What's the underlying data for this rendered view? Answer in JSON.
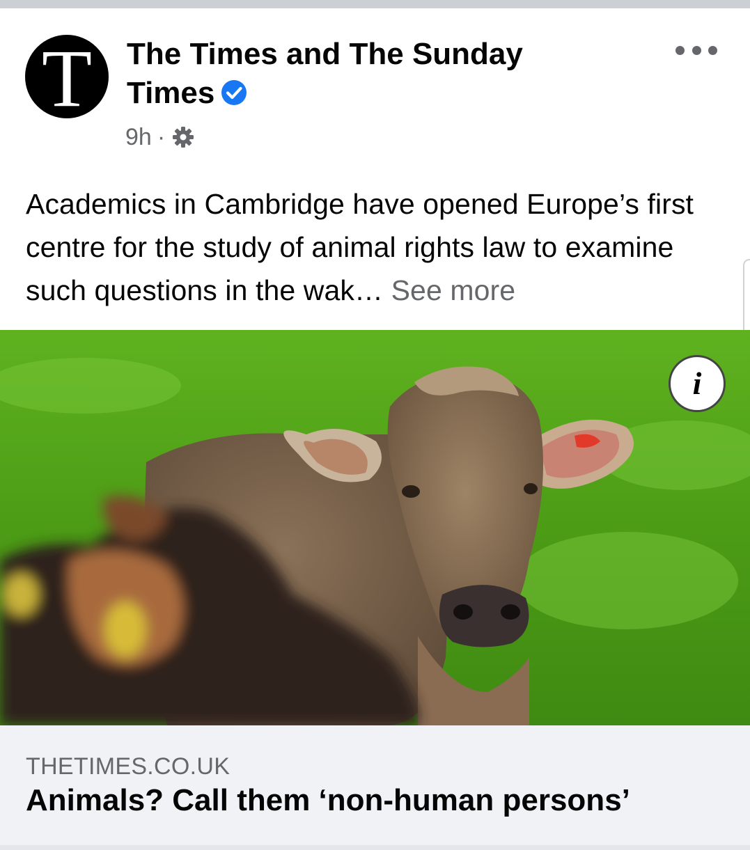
{
  "post": {
    "page_name": "The Times and The Sunday Times",
    "avatar_letter": "T",
    "time": "9h",
    "separator": "·",
    "text": "Academics in Cambridge have opened Europe’s first centre for the study of animal rights law to examine such questions in the wak…",
    "see_more": "See more"
  },
  "link": {
    "domain": "THETIMES.CO.UK",
    "title": "Animals? Call them ‘non-human persons’"
  },
  "icons": {
    "verified": "verified-badge-icon",
    "privacy": "gear-icon",
    "options": "more-options-icon",
    "info": "info-icon"
  },
  "colors": {
    "verified_blue": "#1877f2",
    "secondary_text": "#65676b",
    "link_bg": "#f0f2f5"
  }
}
